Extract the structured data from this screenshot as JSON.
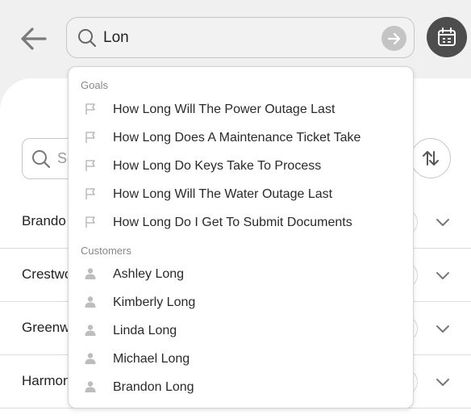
{
  "search": {
    "value": "Lon"
  },
  "background": {
    "search_placeholder": "Se",
    "rows": [
      "Brando",
      "Crestwo",
      "Greenw",
      "Harmon"
    ]
  },
  "dropdown": {
    "goals_title": "Goals",
    "goals": [
      "How Long Will The Power Outage Last",
      "How Long Does A Maintenance Ticket Take",
      "How Long Do Keys Take To Process",
      "How Long Will The Water Outage Last",
      "How Long Do I Get To Submit Documents"
    ],
    "customers_title": "Customers",
    "customers": [
      "Ashley Long",
      "Kimberly Long",
      "Linda Long",
      "Michael Long",
      "Brandon Long"
    ]
  },
  "icons": {
    "back": "arrow-left-icon",
    "search": "search-icon",
    "go": "arrow-right-circle-icon",
    "calendar": "calendar-icon",
    "sort": "sort-icon",
    "goal": "flag-icon",
    "customer": "person-icon",
    "row_expand": "chevron-down-icon"
  },
  "colors": {
    "accent_dark": "#4d4d4d",
    "go_button": "#c4c4c4"
  }
}
